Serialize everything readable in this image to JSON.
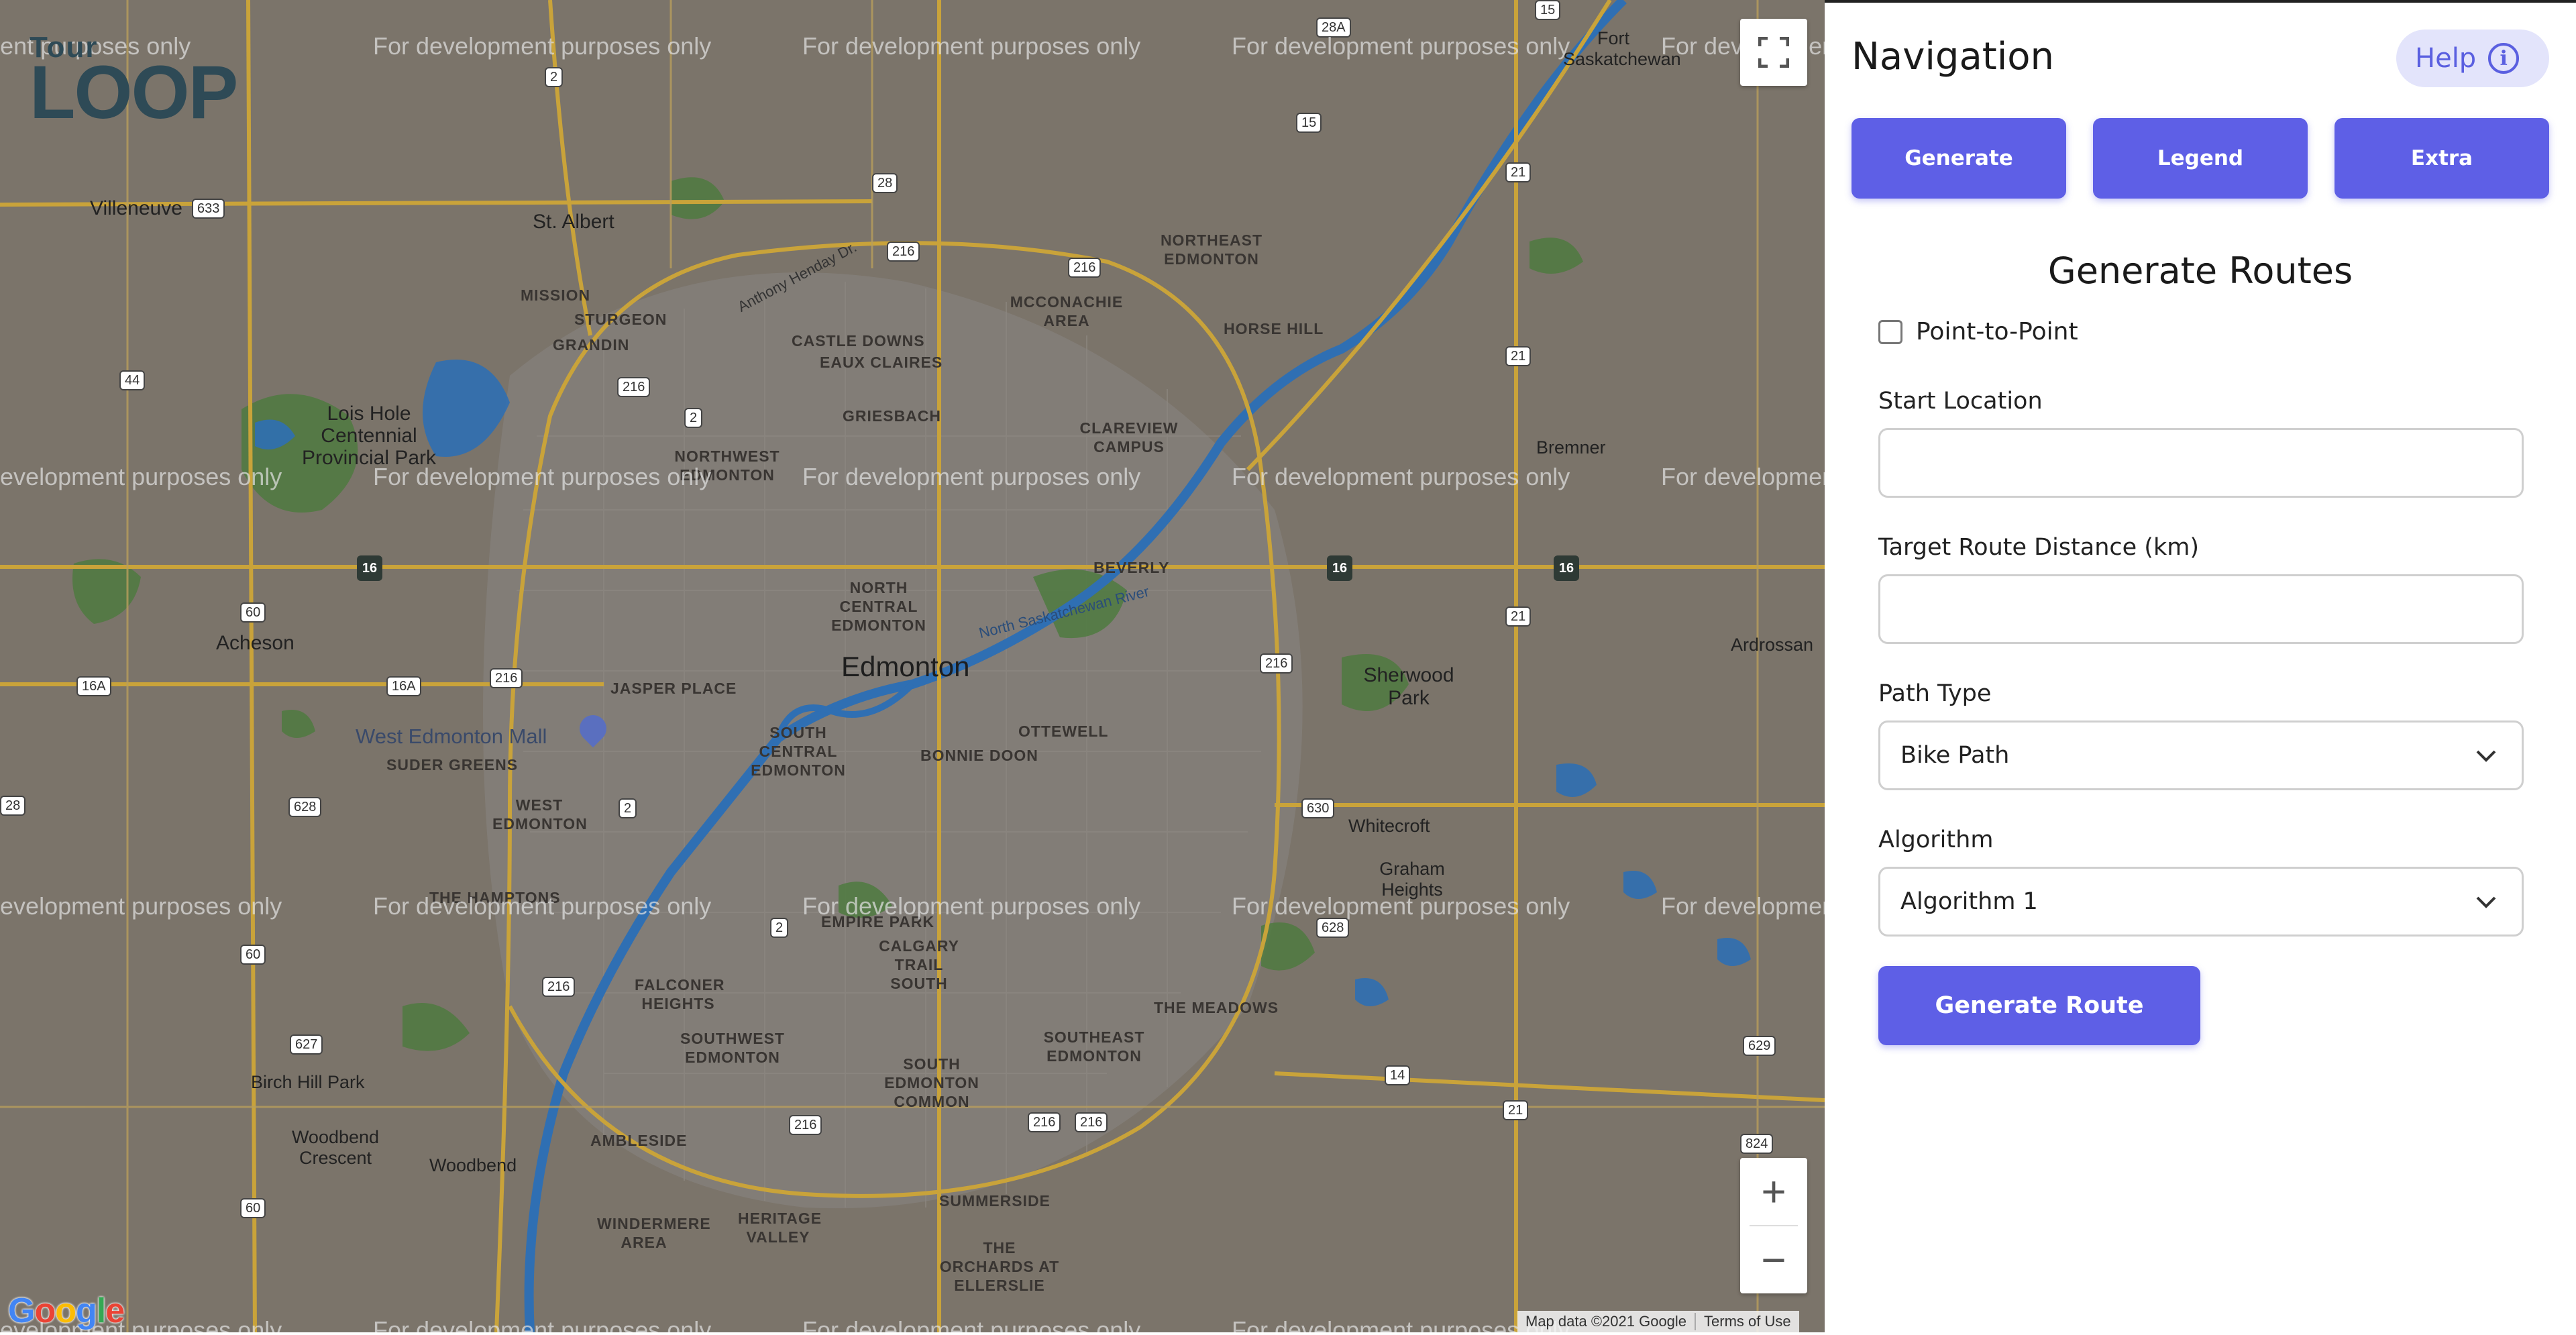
{
  "map": {
    "logo_top": "Tour",
    "logo_bottom": "LOOP",
    "watermark": "For development purposes only",
    "city_label": "Edmonton",
    "place_labels": [
      "St. Albert",
      "Villeneuve",
      "Lois Hole Centennial Provincial Park",
      "Acheson",
      "West Edmonton Mall",
      "Sherwood Park",
      "Bremner",
      "Ardrossan",
      "Birch Hill Park",
      "Woodbend Crescent",
      "Woodbend",
      "Whitecroft",
      "Graham Heights",
      "Fort Saskatchewan"
    ],
    "neighbourhood_labels": [
      "MISSION",
      "STURGEON",
      "GRANDIN",
      "CASTLE DOWNS",
      "EAUX CLAIRES",
      "MCCONACHIE AREA",
      "NORTHEAST EDMONTON",
      "HORSE HILL",
      "GRIESBACH",
      "CLAREVIEW CAMPUS",
      "NORTHWEST EDMONTON",
      "NORTH CENTRAL EDMONTON",
      "BEVERLY",
      "JASPER PLACE",
      "SOUTH CENTRAL EDMONTON",
      "OTTEWELL",
      "BONNIE DOON",
      "SUDER GREENS",
      "WEST EDMONTON",
      "THE HAMPTONS",
      "EMPIRE PARK",
      "CALGARY TRAIL SOUTH",
      "FALCONER HEIGHTS",
      "SOUTHWEST EDMONTON",
      "SOUTHEAST EDMONTON",
      "THE MEADOWS",
      "SOUTH EDMONTON COMMON",
      "AMBLESIDE",
      "HERITAGE VALLEY",
      "WINDERMERE AREA",
      "SUMMERSIDE",
      "THE ORCHARDS AT ELLERSLIE"
    ],
    "road_label": "Anthony Henday Dr.",
    "river_label": "North Saskatchewan River",
    "zoom_in": "+",
    "zoom_out": "−",
    "google_logo": "Google",
    "attribution": "Map data ©2021 Google",
    "terms": "Terms of Use"
  },
  "panel": {
    "title": "Navigation",
    "help_label": "Help",
    "tabs": [
      {
        "label": "Generate"
      },
      {
        "label": "Legend"
      },
      {
        "label": "Extra"
      }
    ],
    "section_title": "Generate Routes",
    "point_to_point_label": "Point-to-Point",
    "point_to_point_checked": false,
    "start_location_label": "Start Location",
    "start_location_value": "",
    "target_distance_label": "Target Route Distance (km)",
    "target_distance_value": "",
    "path_type_label": "Path Type",
    "path_type_value": "Bike Path",
    "algorithm_label": "Algorithm",
    "algorithm_value": "Algorithm 1",
    "generate_button": "Generate Route"
  },
  "colors": {
    "accent": "#5e5fe6",
    "help_bg": "#e3e4fb",
    "map_bg": "#7b746a",
    "river": "#2f6fb3",
    "park": "#4f7a3f",
    "highway": "#c9a33a"
  }
}
